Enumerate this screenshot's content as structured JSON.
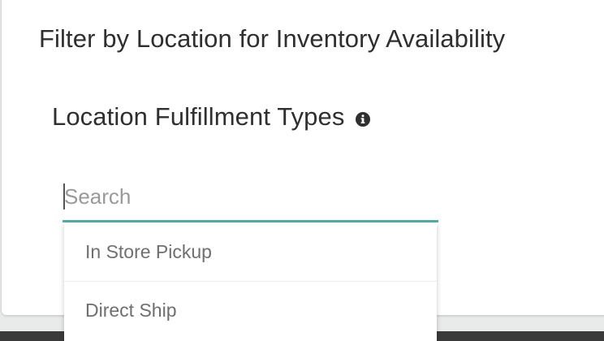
{
  "panel": {
    "title": "Filter by Location for Inventory Availability"
  },
  "section": {
    "heading": "Location Fulfillment Types",
    "info_icon": "info-circle-icon"
  },
  "search": {
    "placeholder": "Search",
    "value": "",
    "accent_color": "#57aba2"
  },
  "dropdown": {
    "options": [
      {
        "label": "In Store Pickup"
      },
      {
        "label": "Direct Ship"
      }
    ]
  }
}
